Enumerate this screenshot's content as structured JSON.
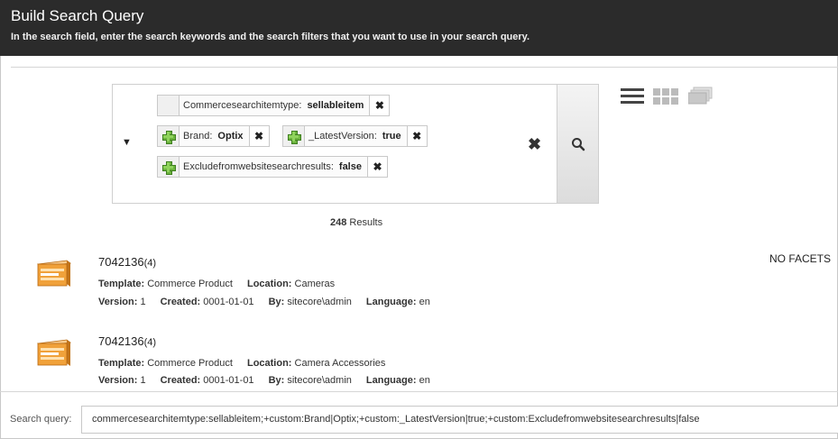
{
  "header": {
    "title": "Build Search Query",
    "subtitle": "In the search field, enter the search keywords and the search filters that you want to use in your search query."
  },
  "search": {
    "chips": [
      {
        "field": "Commercesearchitemtype:",
        "value": "sellableitem",
        "icon": "blank"
      },
      {
        "field": "Brand:",
        "value": "Optix",
        "icon": "plus-icon"
      },
      {
        "field": "_LatestVersion:",
        "value": "true",
        "icon": "plus-icon"
      },
      {
        "field": "Excludefromwebsitesearchresults:",
        "value": "false",
        "icon": "plus-icon"
      }
    ],
    "remove_glyph": "✖",
    "clear_glyph": "✖",
    "dropdown_glyph": "▼"
  },
  "results_count": {
    "number": "248",
    "label": " Results"
  },
  "facets_label": "NO FACETS",
  "results": [
    {
      "name": "7042136",
      "count": "(4)",
      "template_label": "Template:",
      "template": "Commerce Product",
      "location_label": "Location:",
      "location": "Cameras",
      "version_label": "Version:",
      "version": "1",
      "created_label": "Created:",
      "created": "0001-01-01",
      "by_label": "By:",
      "by": "sitecore\\admin",
      "language_label": "Language:",
      "language": "en"
    },
    {
      "name": "7042136",
      "count": "(4)",
      "template_label": "Template:",
      "template": "Commerce Product",
      "location_label": "Location:",
      "location": "Camera Accessories",
      "version_label": "Version:",
      "version": "1",
      "created_label": "Created:",
      "created": "0001-01-01",
      "by_label": "By:",
      "by": "sitecore\\admin",
      "language_label": "Language:",
      "language": "en"
    }
  ],
  "query": {
    "label": "Search query:",
    "value": "commercesearchitemtype:sellableitem;+custom:Brand|Optix;+custom:_LatestVersion|true;+custom:Excludefromwebsitesearchresults|false"
  },
  "colors": {
    "header_bg": "#2b2b2b",
    "plus_green": "#6cb33e",
    "thumb_orange": "#f0a13a"
  }
}
